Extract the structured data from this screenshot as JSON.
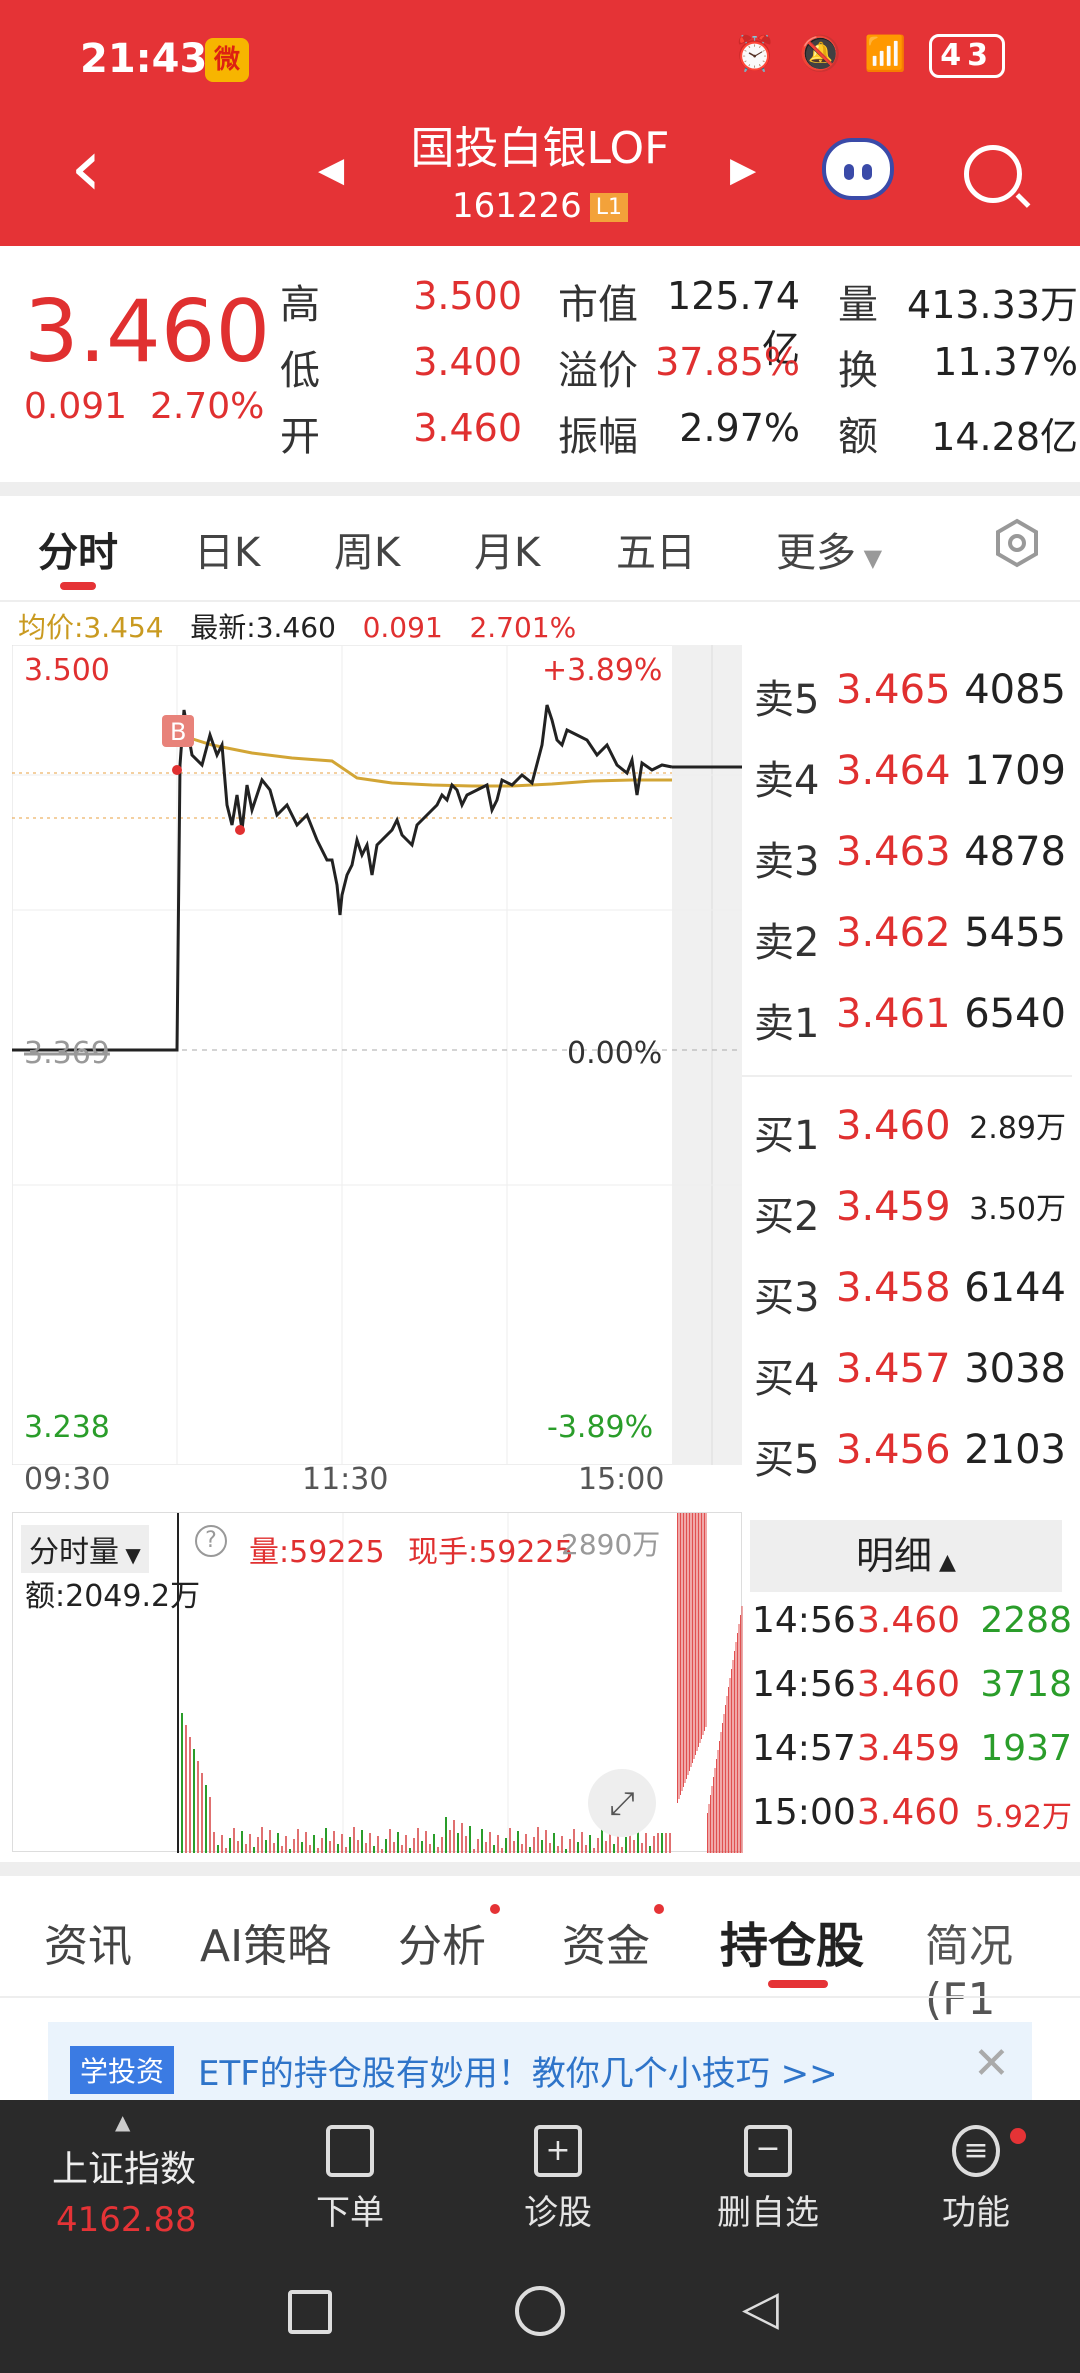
{
  "status": {
    "time": "21:43",
    "battery": "43"
  },
  "header": {
    "title": "国投白银LOF",
    "code": "161226",
    "level": "L1"
  },
  "quote": {
    "price": "3.460",
    "change": "0.091",
    "change_pct": "2.70%",
    "high_label": "高",
    "high": "3.500",
    "low_label": "低",
    "low": "3.400",
    "open_label": "开",
    "open": "3.460",
    "mcap_label": "市值",
    "mcap": "125.74亿",
    "premium_label": "溢价",
    "premium": "37.85%",
    "amplitude_label": "振幅",
    "amplitude": "2.97%",
    "vol_label": "量",
    "vol": "413.33万",
    "turnover_label": "换",
    "turnover": "11.37%",
    "amount_label": "额",
    "amount": "14.28亿"
  },
  "period_tabs": [
    "分时",
    "日K",
    "周K",
    "月K",
    "五日",
    "更多"
  ],
  "chart_info": {
    "avg": "均价:3.454",
    "latest": "最新:3.460",
    "chg": "0.091",
    "pct": "2.701%"
  },
  "chart_labels": {
    "top": "3.500",
    "top_pct": "+3.89%",
    "mid": "3.369",
    "mid_pct": "0.00%",
    "bottom": "3.238",
    "bottom_pct": "-3.89%",
    "t1": "09:30",
    "t2": "11:30",
    "t3": "15:00",
    "marker": "B"
  },
  "volume": {
    "mode": "分时量",
    "vol": "量:59225",
    "hand": "现手:59225",
    "max": "2890万",
    "amount": "额:2049.2万"
  },
  "order_book": {
    "sell": [
      {
        "label": "卖5",
        "price": "3.465",
        "qty": "4085"
      },
      {
        "label": "卖4",
        "price": "3.464",
        "qty": "1709"
      },
      {
        "label": "卖3",
        "price": "3.463",
        "qty": "4878"
      },
      {
        "label": "卖2",
        "price": "3.462",
        "qty": "5455"
      },
      {
        "label": "卖1",
        "price": "3.461",
        "qty": "6540"
      }
    ],
    "buy": [
      {
        "label": "买1",
        "price": "3.460",
        "qty": "2.89万"
      },
      {
        "label": "买2",
        "price": "3.459",
        "qty": "3.50万"
      },
      {
        "label": "买3",
        "price": "3.458",
        "qty": "6144"
      },
      {
        "label": "买4",
        "price": "3.457",
        "qty": "3038"
      },
      {
        "label": "买5",
        "price": "3.456",
        "qty": "2103"
      }
    ]
  },
  "detail": {
    "title": "明细",
    "rows": [
      {
        "time": "14:56",
        "price": "3.460",
        "qty": "2288"
      },
      {
        "time": "14:56",
        "price": "3.460",
        "qty": "3718"
      },
      {
        "time": "14:57",
        "price": "3.459",
        "qty": "1937"
      },
      {
        "time": "15:00",
        "price": "3.460",
        "qty": "5.92万"
      }
    ]
  },
  "info_tabs": [
    "资讯",
    "AI策略",
    "分析",
    "资金",
    "持仓股",
    "简况(F1"
  ],
  "banner": {
    "tag": "学投资",
    "text": "ETF的持仓股有妙用！教你几个小技巧 >>"
  },
  "bottom_nav": {
    "index_name": "上证指数",
    "index_value": "4162.88",
    "items": [
      "下单",
      "诊股",
      "删自选",
      "功能"
    ]
  },
  "colors": {
    "brand": "#E53336",
    "up": "#E03030",
    "down": "#2a9d2a",
    "avg": "#C99A20"
  }
}
